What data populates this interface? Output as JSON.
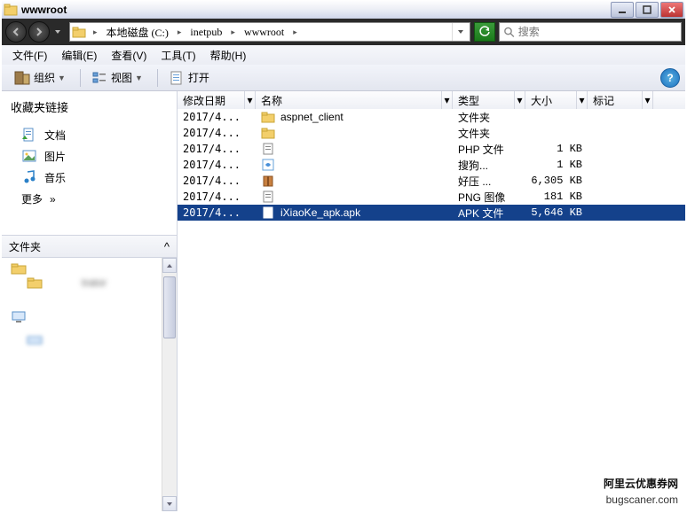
{
  "window": {
    "title": "wwwroot"
  },
  "nav": {
    "breadcrumb": [
      "本地磁盘 (C:)",
      "inetpub",
      "wwwroot"
    ],
    "search_placeholder": "搜索"
  },
  "menu": {
    "file": "文件(F)",
    "edit": "编辑(E)",
    "view": "查看(V)",
    "tools": "工具(T)",
    "help": "帮助(H)"
  },
  "toolbar": {
    "organize": "组织",
    "views": "视图",
    "open": "打开"
  },
  "sidebar": {
    "favorites_title": "收藏夹链接",
    "items": [
      {
        "label": "文档"
      },
      {
        "label": "图片"
      },
      {
        "label": "音乐"
      }
    ],
    "more": "更多",
    "folders_title": "文件夹",
    "tree_label_blur": "trator"
  },
  "columns": {
    "date": "修改日期",
    "name": "名称",
    "type": "类型",
    "size": "大小",
    "tag": "标记"
  },
  "files": [
    {
      "date": "2017/4...",
      "name": "aspnet_client",
      "type": "文件夹",
      "size": "",
      "icon": "folder",
      "selected": false
    },
    {
      "date": "2017/4...",
      "name": "",
      "type": "文件夹",
      "size": "",
      "icon": "folder",
      "selected": false
    },
    {
      "date": "2017/4...",
      "name": "",
      "type": "PHP 文件",
      "size": "1 KB",
      "icon": "file",
      "selected": false
    },
    {
      "date": "2017/4...",
      "name": "",
      "type": "搜狗...",
      "size": "1 KB",
      "icon": "sogou",
      "selected": false
    },
    {
      "date": "2017/4...",
      "name": "",
      "type": "好压 ...",
      "size": "6,305 KB",
      "icon": "archive",
      "selected": false
    },
    {
      "date": "2017/4...",
      "name": "",
      "type": "PNG 图像",
      "size": "181 KB",
      "icon": "png",
      "selected": false
    },
    {
      "date": "2017/4...",
      "name": "iXiaoKe_apk.apk",
      "type": "APK 文件",
      "size": "5,646 KB",
      "icon": "apk",
      "selected": true
    }
  ],
  "watermark": {
    "line1": "阿里云优惠券网",
    "line2": "bugscaner.com"
  }
}
